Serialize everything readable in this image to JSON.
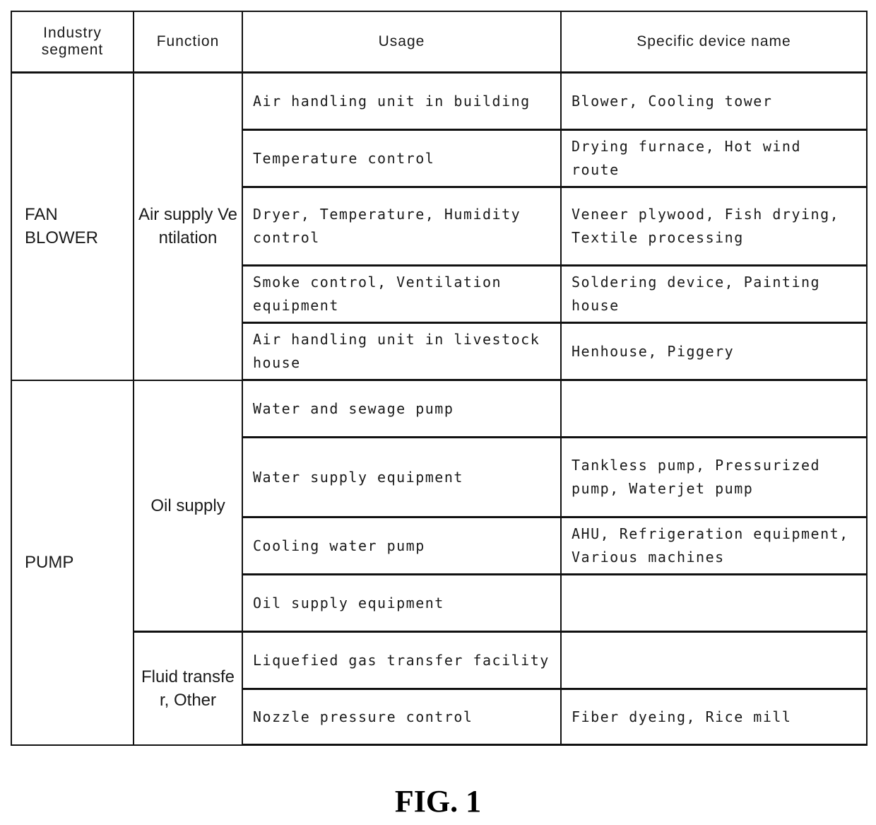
{
  "table": {
    "headers": [
      "Industry segment",
      "Function",
      "Usage",
      "Specific device name"
    ],
    "segments": [
      {
        "segment": "FAN BLOWER",
        "functions": [
          {
            "function": "Air supply Ventilation",
            "rows": [
              {
                "usage": "Air handling unit in building",
                "device": "Blower, Cooling tower"
              },
              {
                "usage": "Temperature control",
                "device": "Drying furnace, Hot wind route"
              },
              {
                "usage": "Dryer, Temperature, Humidity control",
                "device": "Veneer plywood, Fish drying, Textile processing"
              },
              {
                "usage": "Smoke control, Ventilation equipment",
                "device": "Soldering device, Painting house"
              },
              {
                "usage": "Air handling unit in livestock house",
                "device": "Henhouse, Piggery"
              }
            ]
          }
        ]
      },
      {
        "segment": "PUMP",
        "functions": [
          {
            "function": "Oil supply",
            "rows": [
              {
                "usage": "Water and sewage pump",
                "device": ""
              },
              {
                "usage": "Water supply equipment",
                "device": "Tankless pump, Pressurized pump, Waterjet pump"
              },
              {
                "usage": "Cooling water pump",
                "device": "AHU, Refrigeration equipment, Various machines"
              },
              {
                "usage": "Oil supply equipment",
                "device": ""
              }
            ]
          },
          {
            "function": "Fluid transfer, Other",
            "rows": [
              {
                "usage": "Liquefied gas transfer facility",
                "device": ""
              },
              {
                "usage": "Nozzle pressure control",
                "device": "Fiber dyeing, Rice mill"
              }
            ]
          }
        ]
      }
    ]
  },
  "figure_label": "FIG. 1"
}
